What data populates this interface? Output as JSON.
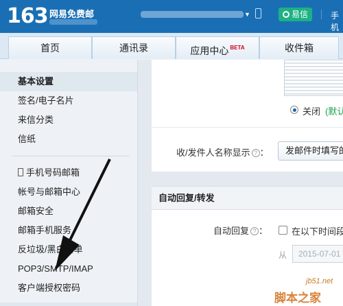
{
  "header": {
    "logo_number": "163",
    "logo_text": "网易免费邮",
    "yixin_label": "易信",
    "cut_text": "手机"
  },
  "nav": {
    "tabs": [
      {
        "label": "首页"
      },
      {
        "label": "通讯录"
      },
      {
        "label": "应用中心",
        "badge": "BETA"
      },
      {
        "label": "收件箱"
      }
    ]
  },
  "sidebar": {
    "items": [
      {
        "label": "基本设置",
        "active": true
      },
      {
        "label": "签名/电子名片"
      },
      {
        "label": "来信分类"
      },
      {
        "label": "信纸"
      },
      {
        "label": "手机号码邮箱"
      },
      {
        "label": "帐号与邮箱中心"
      },
      {
        "label": "邮箱安全"
      },
      {
        "label": "邮箱手机服务"
      },
      {
        "label": "反垃圾/黑白名单"
      },
      {
        "label": "POP3/SMTP/IMAP"
      },
      {
        "label": "客户端授权密码"
      }
    ]
  },
  "settings": {
    "radio_label": "关闭",
    "radio_default": "(默认)",
    "sender_label": "收/发件人名称显示",
    "help_glyph": "?",
    "sender_select": "发邮件时填写的",
    "auto_reply_title": "自动回复/转发",
    "auto_reply_label": "自动回复",
    "auto_reply_check": "在以下时间段内",
    "from_label": "从",
    "date_value": "2015-07-01"
  },
  "watermark": {
    "site": "jb51.net",
    "name": "脚本之家"
  },
  "colors": {
    "brand_blue": "#1a6fb4",
    "yixin_green": "#1db184",
    "default_green": "#1aa150"
  }
}
